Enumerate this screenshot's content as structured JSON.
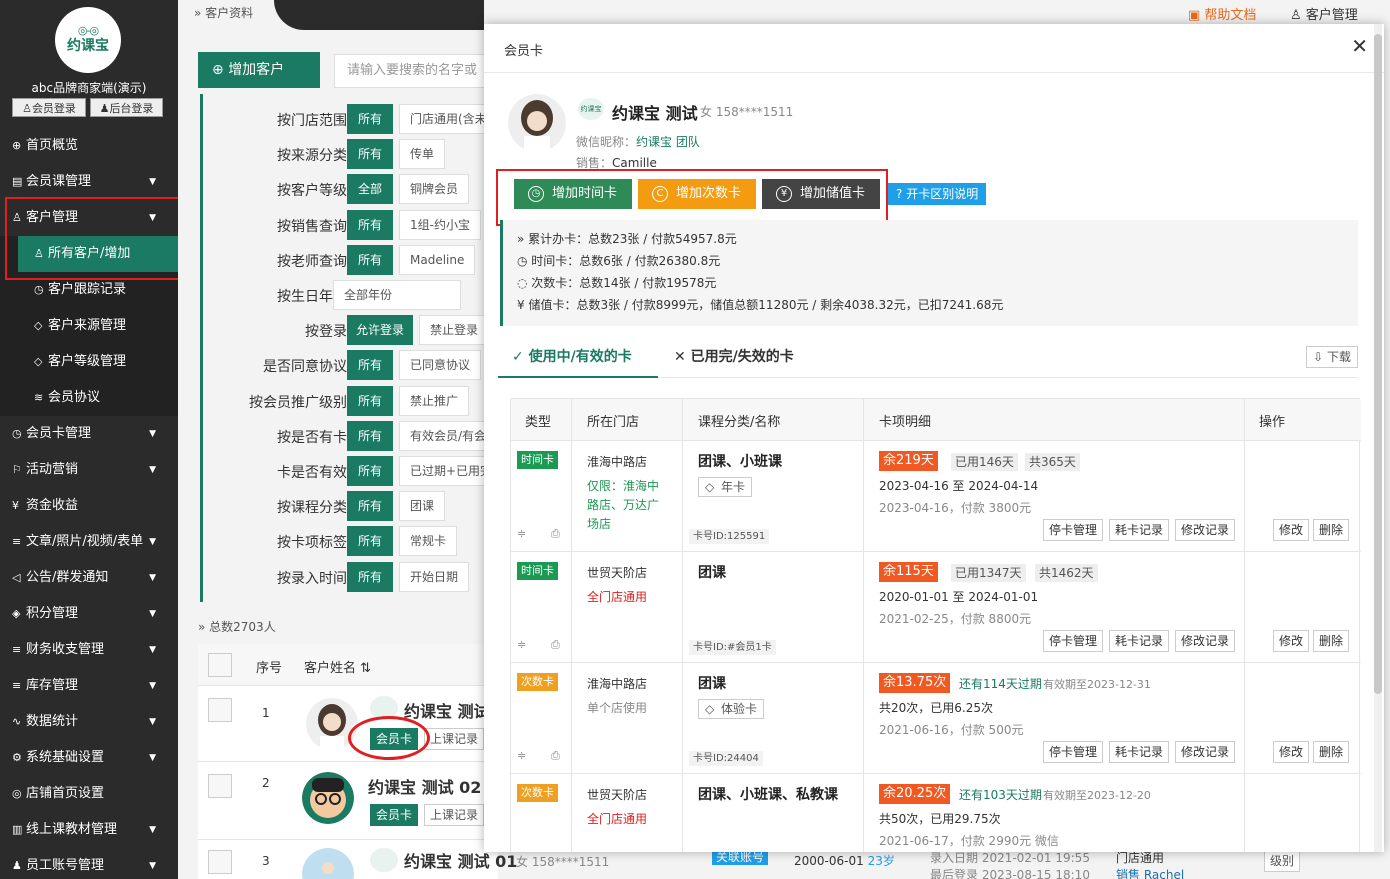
{
  "sidebar": {
    "logo_text": "约课宝",
    "brand": "abc品牌商家端(演示)",
    "member_login": "会员登录",
    "admin_login": "后台登录",
    "menu": [
      {
        "label": "首页概览",
        "icon": "⊕",
        "arrow": ""
      },
      {
        "label": "会员课管理",
        "icon": "▤",
        "arrow": "▼"
      },
      {
        "label": "客户管理",
        "icon": "♙",
        "arrow": "▼"
      },
      {
        "label": "所有客户/增加",
        "icon": "♙",
        "arrow": ""
      },
      {
        "label": "客户跟踪记录",
        "icon": "◷",
        "arrow": ""
      },
      {
        "label": "客户来源管理",
        "icon": "◇",
        "arrow": ""
      },
      {
        "label": "客户等级管理",
        "icon": "◇",
        "arrow": ""
      },
      {
        "label": "会员协议",
        "icon": "≋",
        "arrow": ""
      },
      {
        "label": "会员卡管理",
        "icon": "◷",
        "arrow": "▼"
      },
      {
        "label": "活动营销",
        "icon": "⚐",
        "arrow": "▼"
      },
      {
        "label": "资金收益",
        "icon": "¥",
        "arrow": ""
      },
      {
        "label": "文章/照片/视频/表单",
        "icon": "≡",
        "arrow": "▼"
      },
      {
        "label": "公告/群发通知",
        "icon": "◁",
        "arrow": "▼"
      },
      {
        "label": "积分管理",
        "icon": "◈",
        "arrow": "▼"
      },
      {
        "label": "财务收支管理",
        "icon": "≡",
        "arrow": "▼"
      },
      {
        "label": "库存管理",
        "icon": "≡",
        "arrow": "▼"
      },
      {
        "label": "数据统计",
        "icon": "∿",
        "arrow": "▼"
      },
      {
        "label": "系统基础设置",
        "icon": "⚙",
        "arrow": "▼"
      },
      {
        "label": "店铺首页设置",
        "icon": "◎",
        "arrow": ""
      },
      {
        "label": "线上课教材管理",
        "icon": "▥",
        "arrow": "▼"
      },
      {
        "label": "员工账号管理",
        "icon": "♟",
        "arrow": "▼"
      }
    ]
  },
  "top": {
    "crumb": "客户资料",
    "help": "帮助文档",
    "customer_admin": "客户管理"
  },
  "main": {
    "add_customer": "增加客户",
    "search_placeholder": "请输入要搜索的名字或",
    "filters": [
      {
        "label": "按门店范围",
        "b1": "所有",
        "b2": "门店通用(含未"
      },
      {
        "label": "按来源分类",
        "b1": "所有",
        "b2": "传单"
      },
      {
        "label": "按客户等级",
        "b1": "全部",
        "b2": "铜牌会员"
      },
      {
        "label": "按销售查询",
        "b1": "所有",
        "b2": "1组-约小宝"
      },
      {
        "label": "按老师查询",
        "b1": "所有",
        "b2": "Madeline"
      },
      {
        "label": "按生日年月",
        "b1": "",
        "b2": "全部年份"
      },
      {
        "label": "按登录",
        "b1": "允许登录",
        "b2": "禁止登录"
      },
      {
        "label": "是否同意协议",
        "b1": "所有",
        "b2": "已同意协议"
      },
      {
        "label": "按会员推广级别",
        "b1": "所有",
        "b2": "禁止推广"
      },
      {
        "label": "按是否有卡",
        "b1": "所有",
        "b2": "有效会员/有会"
      },
      {
        "label": "卡是否有效",
        "b1": "所有",
        "b2": "已过期+已用完"
      },
      {
        "label": "按课程分类",
        "b1": "所有",
        "b2": "团课"
      },
      {
        "label": "按卡项标签",
        "b1": "所有",
        "b2": "常规卡"
      },
      {
        "label": "按录入时间",
        "b1": "所有",
        "b2": "开始日期"
      }
    ],
    "total": "总数2703人",
    "table": {
      "col_seq": "序号",
      "col_name": "客户姓名",
      "rows": [
        {
          "seq": "1",
          "name": "约课宝 测试",
          "card_btn": "会员卡",
          "record_btn": "上课记录"
        },
        {
          "seq": "2",
          "name": "约课宝 测试 02",
          "card_btn": "会员卡",
          "record_btn": "上课记录"
        },
        {
          "seq": "3",
          "name": "约课宝 测试 01",
          "gender_phone": "女 158****1511",
          "linked": "关联账号",
          "birth": "2000-06-01",
          "age": "23岁",
          "entered": "录入日期 2021-02-01 19:55",
          "last_login": "最后登录 2023-08-15 18:10",
          "store": "门店通用",
          "sales": "销售 Rachel",
          "level_btn": "级别"
        }
      ]
    }
  },
  "modal": {
    "title": "会员卡",
    "name": "约课宝 测试",
    "gender_phone": "女 158****1511",
    "wechat_label": "微信昵称：",
    "wechat": "约课宝 团队",
    "sales_label": "销售：",
    "sales": "Camille",
    "btn_time": "增加时间卡",
    "btn_count": "增加次数卡",
    "btn_value": "增加储值卡",
    "btn_diff": "开卡区别说明",
    "stats": [
      "累计办卡：总数23张 / 付款54957.8元",
      "时间卡：总数6张 / 付款26380.8元",
      "次数卡：总数14张 / 付款19578元",
      "储值卡：总数3张 / 付款8999元，储值总额11280元 / 剩余4038.32元，已扣7241.68元"
    ],
    "tab_active": "使用中/有效的卡",
    "tab_inactive": "已用完/失效的卡",
    "download": "下载",
    "headers": [
      "类型",
      "所在门店",
      "课程分类/名称",
      "卡项明细",
      "操作"
    ],
    "rows": [
      {
        "type": "时间卡",
        "type_color": "#1a9a52",
        "store": "淮海中路店",
        "scope": "仅限：淮海中路店、万达广场店",
        "scope_color": "#1a9a52",
        "course": "团课、小班课",
        "tag": "年卡",
        "card_id": "卡号ID:125591",
        "remain": "余219天",
        "used": "已用146天",
        "total": "共365天",
        "exp": "",
        "exp_date": "",
        "dates": "2023-04-16 至 2024-04-14",
        "pay": "2023-04-16，付款 3800元"
      },
      {
        "type": "时间卡",
        "type_color": "#1a9a52",
        "store": "世贸天阶店",
        "scope": "全门店通用",
        "scope_color": "#e02020",
        "course": "团课",
        "tag": "",
        "card_id": "卡号ID:#会员1卡",
        "remain": "余115天",
        "used": "已用1347天",
        "total": "共1462天",
        "exp": "",
        "exp_date": "",
        "dates": "2020-01-01 至 2024-01-01",
        "pay": "2021-02-25，付款 8800元"
      },
      {
        "type": "次数卡",
        "type_color": "#f0a020",
        "store": "淮海中路店",
        "scope": "单个店使用",
        "scope_color": "#888",
        "course": "团课",
        "tag": "体验卡",
        "card_id": "卡号ID:24404",
        "remain": "余13.75次",
        "used": "",
        "total": "",
        "exp": "还有114天过期",
        "exp_date": "有效期至2023-12-31",
        "dates": "共20次，已用6.25次",
        "pay": "2021-06-16，付款 500元"
      },
      {
        "type": "次数卡",
        "type_color": "#f0a020",
        "store": "世贸天阶店",
        "scope": "全门店通用",
        "scope_color": "#e02020",
        "course": "团课、小班课、私教课",
        "tag": "",
        "card_id": "",
        "remain": "余20.25次",
        "used": "",
        "total": "",
        "exp": "还有103天过期",
        "exp_date": "有效期至2023-12-20",
        "dates": "共50次，已用29.75次",
        "pay": "2021-06-17，付款 2990元 微信"
      }
    ],
    "actions": {
      "stop": "停卡管理",
      "consume": "耗卡记录",
      "modify_log": "修改记录",
      "edit": "修改",
      "delete": "删除"
    }
  }
}
